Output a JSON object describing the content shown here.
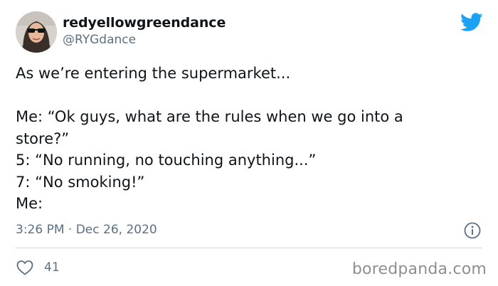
{
  "author": {
    "display_name": "redyellowgreendance",
    "handle": "@RYGdance",
    "avatar_icon": "avatar-photo"
  },
  "brand": {
    "icon": "twitter-bird-icon",
    "color": "#1da1f2"
  },
  "tweet": {
    "lines": [
      "As we’re entering the supermarket...",
      "",
      "Me: “Ok guys, what are the rules when we go into a",
      "store?”",
      "5: “No running, no touching anything...”",
      "7: “No smoking!”",
      "Me:"
    ],
    "timestamp": "3:26 PM · Dec 26, 2020",
    "info_icon": "info-icon",
    "like_icon": "heart-icon",
    "like_count": "41"
  },
  "watermark": "boredpanda.com",
  "colors": {
    "text": "#0f1419",
    "secondary": "#5b7083",
    "divider": "#cfd9de"
  }
}
